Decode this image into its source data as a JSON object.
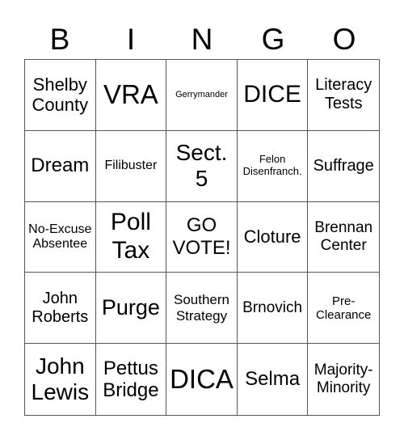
{
  "header": {
    "letters": [
      "B",
      "I",
      "N",
      "G",
      "O"
    ]
  },
  "cells": [
    "Shelby County",
    "VRA",
    "Gerrymander",
    "DICE",
    "Literacy Tests",
    "Dream",
    "Filibuster",
    "Sect. 5",
    "Felon Disenfranch.",
    "Suffrage",
    "No-Excuse Absentee",
    "Poll Tax",
    "GO VOTE!",
    "Cloture",
    "Brennan Center",
    "John Roberts",
    "Purge",
    "Southern Strategy",
    "Brnovich",
    "Pre-Clearance",
    "John Lewis",
    "Pettus Bridge",
    "DICA",
    "Selma",
    "Majority-Minority"
  ]
}
